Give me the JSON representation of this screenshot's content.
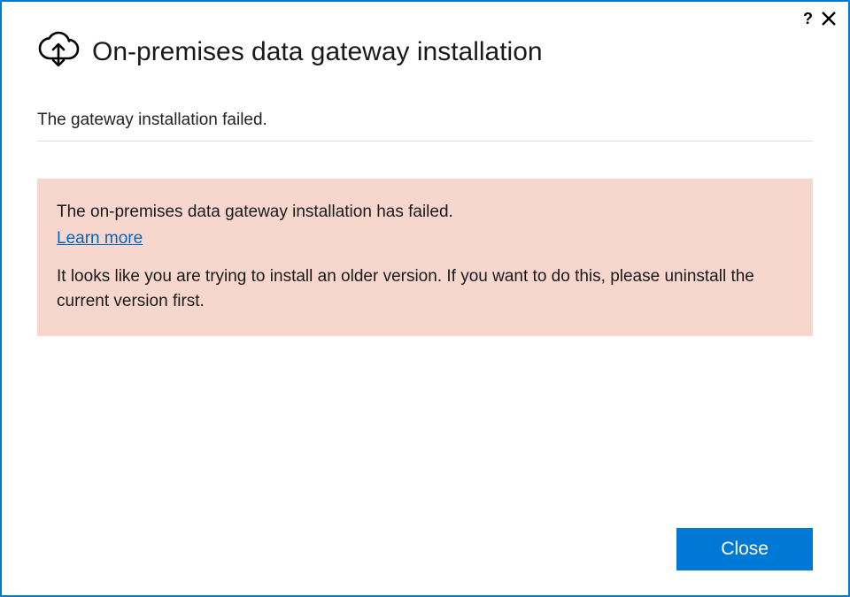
{
  "window": {
    "title": "On-premises data gateway installation"
  },
  "status": {
    "message": "The gateway installation failed."
  },
  "error": {
    "headline": "The on-premises data gateway installation has failed.",
    "learn_more_label": "Learn more",
    "detail": "It looks like you are trying to install an older version. If you want to do this, please uninstall the current version first."
  },
  "footer": {
    "close_label": "Close"
  },
  "titlebar": {
    "help_label": "?",
    "close_label": "✕"
  },
  "colors": {
    "accent": "#0079d6",
    "error_bg": "#f6d6cd",
    "link": "#0067c0"
  }
}
